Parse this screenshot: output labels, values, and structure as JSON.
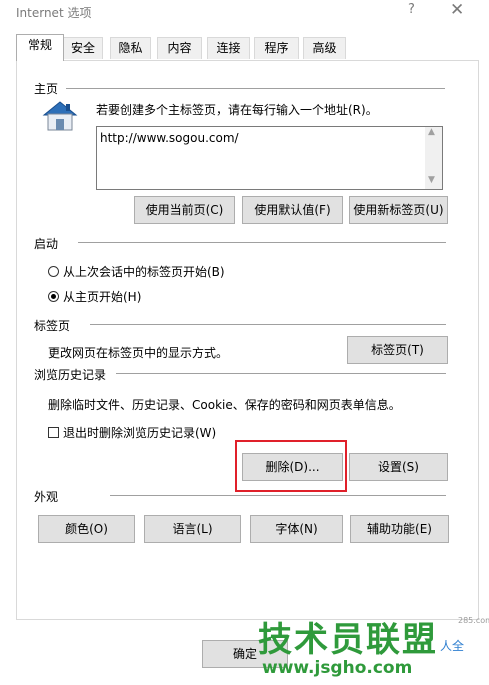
{
  "window": {
    "title": "Internet 选项",
    "help": "?",
    "close": "✕"
  },
  "tabs": [
    {
      "label": "常规",
      "active": true
    },
    {
      "label": "安全"
    },
    {
      "label": "隐私"
    },
    {
      "label": "内容"
    },
    {
      "label": "连接"
    },
    {
      "label": "程序"
    },
    {
      "label": "高级"
    }
  ],
  "homepage": {
    "section": "主页",
    "instruction": "若要创建多个主标签页，请在每行输入一个地址(R)。",
    "url": "http://www.sogou.com/",
    "buttons": {
      "current": "使用当前页(C)",
      "default": "使用默认值(F)",
      "new_tab": "使用新标签页(U)"
    }
  },
  "startup": {
    "section": "启动",
    "option_last": "从上次会话中的标签页开始(B)",
    "option_home": "从主页开始(H)",
    "selected": "home"
  },
  "tabs_section": {
    "section": "标签页",
    "desc": "更改网页在标签页中的显示方式。",
    "button": "标签页(T)"
  },
  "history": {
    "section": "浏览历史记录",
    "desc": "删除临时文件、历史记录、Cookie、保存的密码和网页表单信息。",
    "checkbox": "退出时删除浏览历史记录(W)",
    "checked": false,
    "delete": "删除(D)...",
    "settings": "设置(S)"
  },
  "appearance": {
    "section": "外观",
    "colors": "颜色(O)",
    "languages": "语言(L)",
    "fonts": "字体(N)",
    "accessibility": "辅助功能(E)"
  },
  "footer": {
    "ok": "确定"
  },
  "watermark": {
    "brand": "技术员联盟",
    "url": "www.jsgho.com",
    "small": "人全",
    "tiny": "285.com"
  },
  "colors": {
    "highlight": "#e0202a",
    "watermark": "#2f9a3b"
  }
}
